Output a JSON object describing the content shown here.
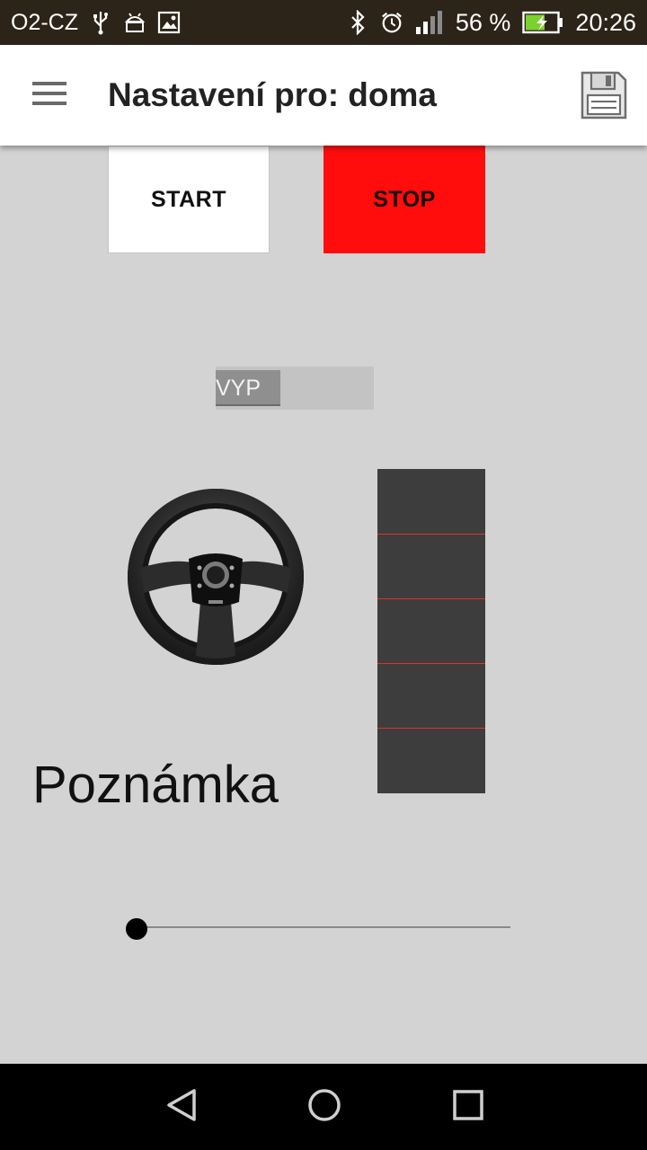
{
  "status_bar": {
    "carrier": "O2-CZ",
    "battery": "56 %",
    "time": "20:26",
    "icons_left": [
      "usb-icon",
      "android-icon",
      "image-icon"
    ],
    "icons_right": [
      "bluetooth-icon",
      "alarm-icon",
      "signal-icon",
      "battery-icon"
    ]
  },
  "app_bar": {
    "title": "Nastavení pro: doma",
    "menu_icon": "hamburger-menu-icon",
    "save_icon": "floppy-disk-icon"
  },
  "buttons": {
    "start_label": "START",
    "stop_label": "STOP",
    "start_color": "#ffffff",
    "stop_color": "#ff0d0d"
  },
  "toggle": {
    "label": "VYP",
    "state": "off"
  },
  "bar_panel": {
    "segments": 5,
    "color": "#3d3d3d",
    "divider_color": "#e03030"
  },
  "note": {
    "text": "Poznámka"
  },
  "slider": {
    "value": 0
  },
  "nav_bar": {
    "icons": [
      "back-icon",
      "home-icon",
      "recents-icon"
    ]
  }
}
